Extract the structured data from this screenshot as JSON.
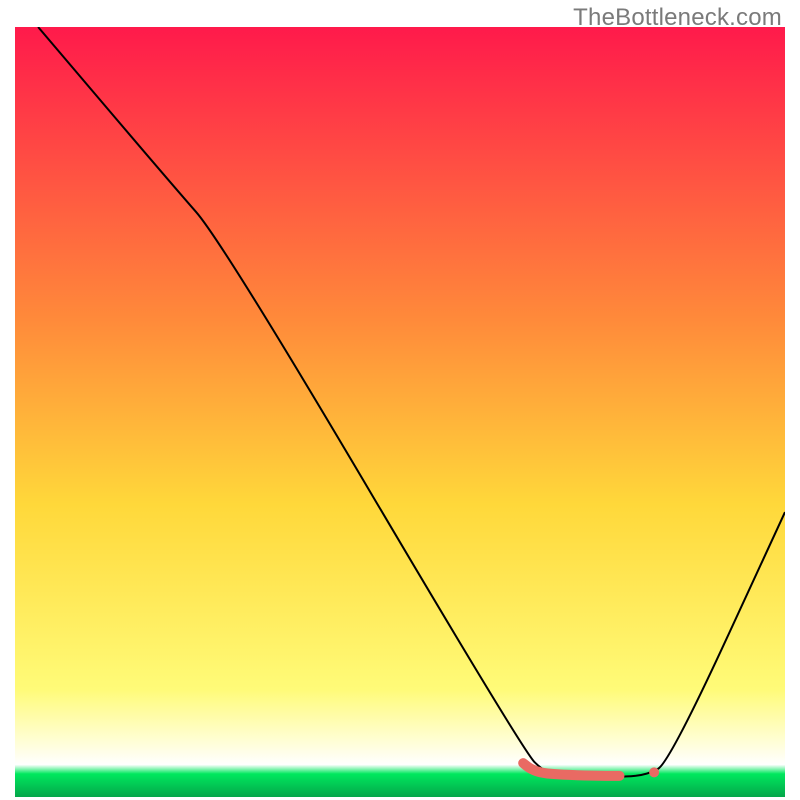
{
  "watermark": "TheBottleneck.com",
  "chart_data": {
    "type": "line",
    "title": "",
    "xlabel": "",
    "ylabel": "",
    "xlim": [
      0,
      100
    ],
    "ylim": [
      0,
      100
    ],
    "grid": false,
    "legend": false,
    "background": {
      "type": "vertical-gradient",
      "stops": [
        {
          "pos": 0.0,
          "color": "#ff1a4b"
        },
        {
          "pos": 0.38,
          "color": "#ff8a3a"
        },
        {
          "pos": 0.62,
          "color": "#ffd83a"
        },
        {
          "pos": 0.86,
          "color": "#fffb78"
        },
        {
          "pos": 0.958,
          "color": "#ffffff"
        },
        {
          "pos": 0.97,
          "color": "#00e85e"
        },
        {
          "pos": 1.0,
          "color": "#04a64a"
        }
      ]
    },
    "series": [
      {
        "name": "curve",
        "style": {
          "stroke": "#000000",
          "width": 2,
          "fill": "none"
        },
        "points": [
          {
            "x": 3,
            "y": 100
          },
          {
            "x": 20,
            "y": 80
          },
          {
            "x": 27,
            "y": 72
          },
          {
            "x": 66,
            "y": 6
          },
          {
            "x": 69,
            "y": 3
          },
          {
            "x": 72,
            "y": 2.6
          },
          {
            "x": 78,
            "y": 2.6
          },
          {
            "x": 82,
            "y": 2.8
          },
          {
            "x": 85,
            "y": 4.5
          },
          {
            "x": 100,
            "y": 37
          }
        ]
      },
      {
        "name": "bottom-marker",
        "style": {
          "stroke": "#e96a63",
          "width": 10,
          "linecap": "round"
        },
        "points": [
          {
            "x": 66,
            "y": 4.4
          },
          {
            "x": 67,
            "y": 3.6
          },
          {
            "x": 68.5,
            "y": 3.1
          },
          {
            "x": 71,
            "y": 2.9
          },
          {
            "x": 75,
            "y": 2.75
          },
          {
            "x": 78.5,
            "y": 2.75
          }
        ]
      },
      {
        "name": "bottom-dot",
        "style": {
          "fill": "#e96a63",
          "r": 5
        },
        "points": [
          {
            "x": 83,
            "y": 3.2
          }
        ]
      }
    ]
  }
}
